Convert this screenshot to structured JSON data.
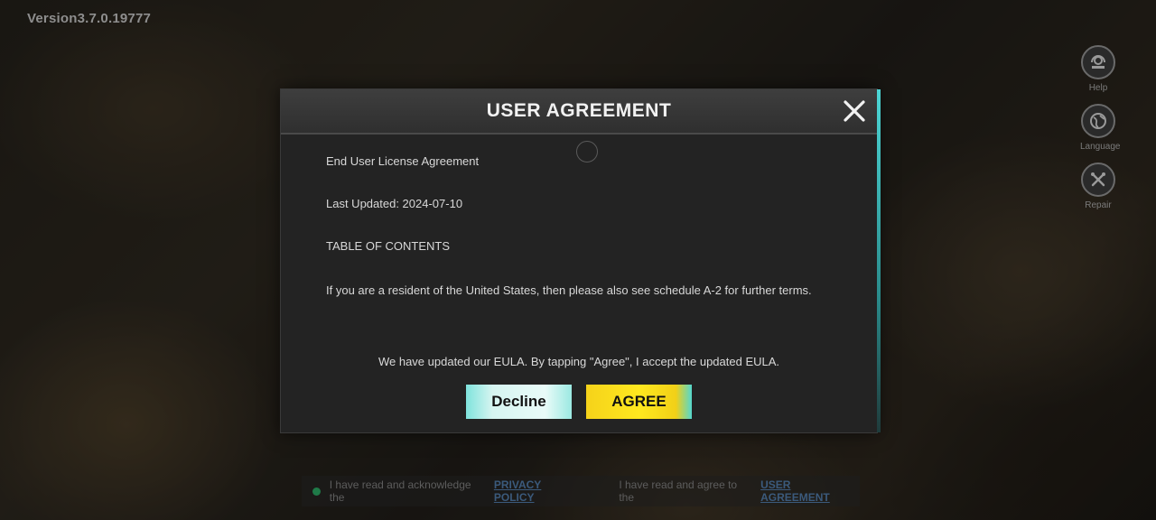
{
  "version_text": "Version3.7.0.19777",
  "side_menu": {
    "help": {
      "label": "Help",
      "icon": "headset-icon"
    },
    "language": {
      "label": "Language",
      "icon": "globe-icon"
    },
    "repair": {
      "label": "Repair",
      "icon": "wrench-icon"
    }
  },
  "dialog": {
    "title": "USER AGREEMENT",
    "close_icon": "close-icon",
    "lines": [
      "End User License Agreement",
      "Last Updated: 2024-07-10",
      "TABLE OF CONTENTS",
      "If you are a resident of the United States, then please also see schedule A-2 for further terms."
    ],
    "notice": "We have updated our EULA. By tapping \"Agree\", I accept the updated EULA.",
    "decline_label": "Decline",
    "agree_label": "AGREE"
  },
  "bottom_bar": {
    "privacy_prefix": "I have read and acknowledge the",
    "privacy_link": "PRIVACY POLICY",
    "agreement_prefix": "I have read and agree to the",
    "agreement_link": "USER AGREEMENT"
  },
  "colors": {
    "accent_cyan": "#4cd6d6",
    "agree_yellow": "#ffe81f",
    "decline_mint": "#d6f5f1"
  }
}
